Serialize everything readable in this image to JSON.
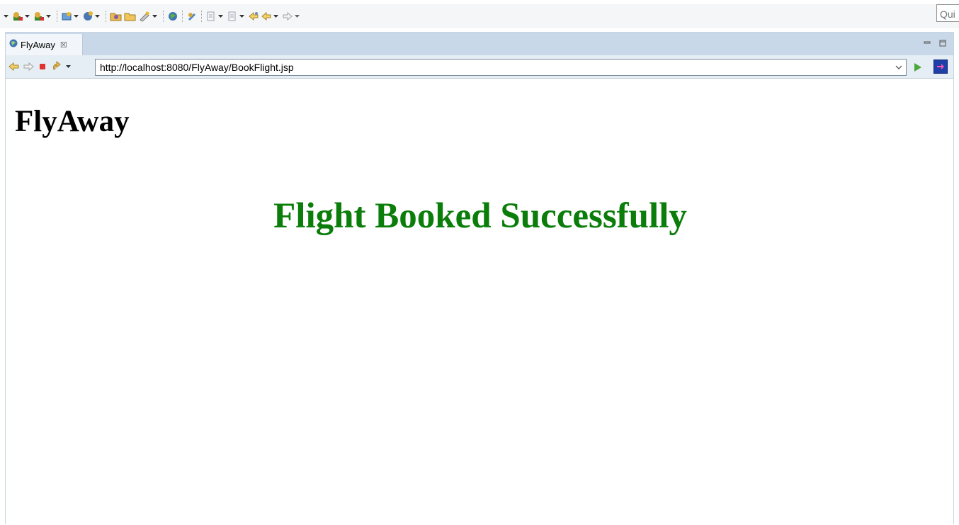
{
  "toolbar": {
    "quick_access_placeholder": "Qui",
    "icons": [
      "debug-icon",
      "run-icon",
      "run-external-icon",
      "new-server-icon",
      "new-class-icon",
      "open-type-icon",
      "open-folder-icon",
      "search-icon",
      "web-browser-icon",
      "annotation-icon",
      "next-annotation-icon",
      "prev-annotation-icon",
      "last-edit-icon",
      "back-icon",
      "forward-icon"
    ]
  },
  "tab": {
    "title": "FlyAway",
    "close_symbol": "☒"
  },
  "navbar": {
    "url": "http://localhost:8080/FlyAway/BookFlight.jsp"
  },
  "page": {
    "site_title": "FlyAway",
    "message": "Flight Booked Successfully",
    "message_color": "#0a7d0a"
  }
}
